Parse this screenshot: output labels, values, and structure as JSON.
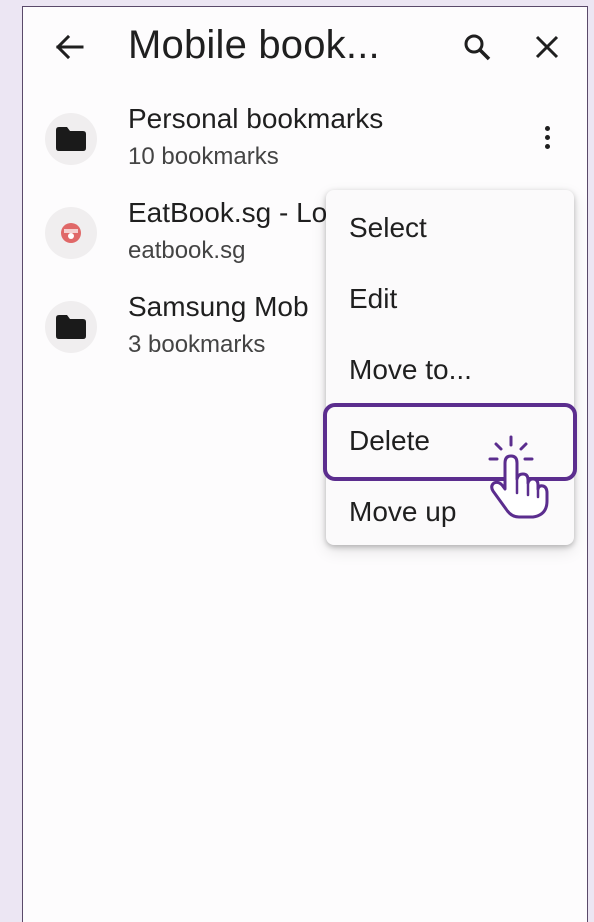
{
  "header": {
    "title": "Mobile book...",
    "back_icon": "arrow-left-icon",
    "search_icon": "search-icon",
    "close_icon": "close-icon"
  },
  "bookmarks": [
    {
      "name": "Personal bookmarks",
      "sub": "10 bookmarks",
      "icon": "folder-icon"
    },
    {
      "name": "EatBook.sg - Lo",
      "sub": "eatbook.sg",
      "icon": "site-favicon"
    },
    {
      "name": "Samsung Mob",
      "sub": "3 bookmarks",
      "icon": "folder-icon"
    }
  ],
  "menu": {
    "items": [
      "Select",
      "Edit",
      "Move to...",
      "Delete",
      "Move up"
    ],
    "highlighted": "Delete"
  },
  "colors": {
    "highlight": "#5b2d8e",
    "background": "#ece6f3"
  }
}
